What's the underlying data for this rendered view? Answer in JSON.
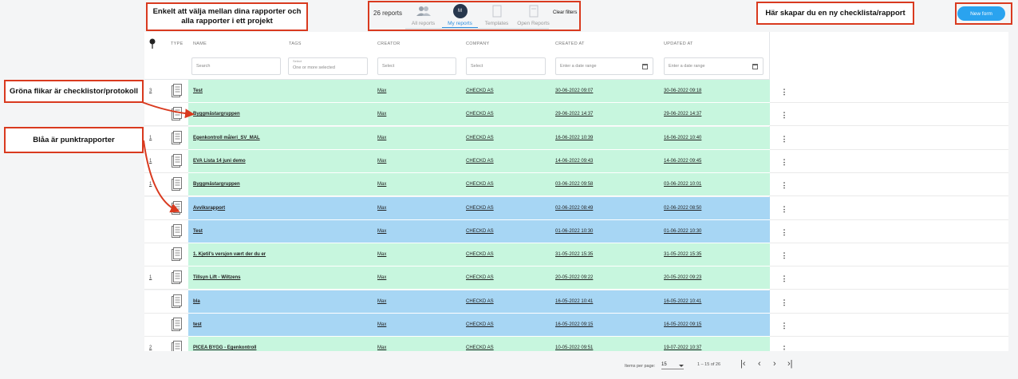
{
  "header": {
    "report_count": "26 reports",
    "tabs": [
      {
        "label": "All reports",
        "icon": "people-icon",
        "active": false
      },
      {
        "label": "My reports",
        "icon": "avatar",
        "avatar_initial": "M",
        "active": true
      },
      {
        "label": "Templates",
        "icon": "document-icon",
        "active": false
      },
      {
        "label": "Open Reports",
        "icon": "open-document-icon",
        "active": false
      }
    ],
    "clear_filters": "Clear filters",
    "new_form": "New form"
  },
  "annotations": {
    "top_center": "Enkelt att välja mellan dina rapporter och alla rapporter i ett projekt",
    "top_right": "Här skapar du en ny checklista/rapport",
    "green": "Gröna flikar är checklistor/protokoll",
    "blue": "Blåa är punktrapporter"
  },
  "table": {
    "columns": {
      "type": "TYPE",
      "name": "NAME",
      "tags": "TAGS",
      "creator": "CREATOR",
      "company": "COMPANY",
      "created_at": "CREATED AT",
      "updated_at": "UPDATED AT"
    },
    "filters": {
      "search_placeholder": "Search",
      "tags_small": "Select",
      "tags_placeholder": "One or more selected",
      "creator_placeholder": "Select",
      "company_placeholder": "Select",
      "created_placeholder": "Enter a date range",
      "updated_placeholder": "Enter a date range"
    },
    "rows": [
      {
        "num": "3",
        "name": "Test",
        "creator": "Max",
        "company": "CHECKD AS",
        "created": "30-06-2022 09:07",
        "updated": "30-06-2022 09:18",
        "color": "green"
      },
      {
        "num": "",
        "name": "Byggmästargruppen",
        "creator": "Max",
        "company": "CHECKD AS",
        "created": "29-06-2022 14:37",
        "updated": "29-06-2022 14:37",
        "color": "green"
      },
      {
        "num": "1",
        "name": "Egenkontroll måleri_SV_MAL",
        "creator": "Max",
        "company": "CHECKD AS",
        "created": "16-06-2022 10:39",
        "updated": "16-06-2022 10:40",
        "color": "green"
      },
      {
        "num": "1",
        "name": "EVA Lista 14 juni demo",
        "creator": "Max",
        "company": "CHECKD AS",
        "created": "14-06-2022 09:43",
        "updated": "14-06-2022 09:45",
        "color": "green"
      },
      {
        "num": "1",
        "name": "Byggmästargruppen",
        "creator": "Max",
        "company": "CHECKD AS",
        "created": "03-06-2022 09:58",
        "updated": "03-06-2022 10:01",
        "color": "green"
      },
      {
        "num": "",
        "name": "Avviksrapport",
        "creator": "Max",
        "company": "CHECKD AS",
        "created": "02-06-2022 08:49",
        "updated": "02-06-2022 08:50",
        "color": "blue"
      },
      {
        "num": "",
        "name": "Test",
        "creator": "Max",
        "company": "CHECKD AS",
        "created": "01-06-2022 10:30",
        "updated": "01-06-2022 10:30",
        "color": "blue"
      },
      {
        "num": "",
        "name": "1. Kjetil's versjon vært der du er",
        "creator": "Max",
        "company": "CHECKD AS",
        "created": "31-05-2022 15:35",
        "updated": "31-05-2022 15:35",
        "color": "green"
      },
      {
        "num": "1",
        "name": "Tillsyn Lift - Wiltzens",
        "creator": "Max",
        "company": "CHECKD AS",
        "created": "20-05-2022 09:22",
        "updated": "20-05-2022 09:23",
        "color": "green"
      },
      {
        "num": "",
        "name": "bla",
        "creator": "Max",
        "company": "CHECKD AS",
        "created": "16-05-2022 10:41",
        "updated": "16-05-2022 10:41",
        "color": "blue"
      },
      {
        "num": "",
        "name": "test",
        "creator": "Max",
        "company": "CHECKD AS",
        "created": "16-05-2022 09:15",
        "updated": "16-05-2022 09:15",
        "color": "blue"
      },
      {
        "num": "2",
        "name": "PICEA BYGG - Egenkontroll",
        "creator": "Max",
        "company": "CHECKD AS",
        "created": "10-05-2022 09:51",
        "updated": "19-07-2022 10:37",
        "color": "green"
      }
    ]
  },
  "pagination": {
    "items_per_page_label": "Items per page:",
    "items_per_page": "15",
    "range": "1 – 15 of 26"
  },
  "colors": {
    "green_row": "#c7f6de",
    "blue_row": "#a7d6f4",
    "accent": "#2aa3ef",
    "annotation_border": "#d93a1f"
  }
}
